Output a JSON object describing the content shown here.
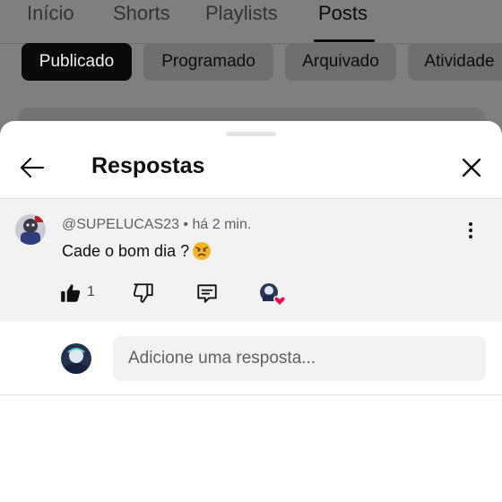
{
  "background": {
    "tabs": [
      {
        "label": "Início"
      },
      {
        "label": "Shorts"
      },
      {
        "label": "Playlists"
      },
      {
        "label": "Posts"
      }
    ],
    "active_tab": "Posts",
    "chips": [
      {
        "label": "Publicado"
      },
      {
        "label": "Programado"
      },
      {
        "label": "Arquivado"
      },
      {
        "label": "Atividade"
      }
    ],
    "active_chip": "Publicado"
  },
  "sheet": {
    "title": "Respostas",
    "icons": {
      "back": "arrow-left-icon",
      "close": "close-icon"
    }
  },
  "comment": {
    "author": "@SUPELUCAS23",
    "separator": "•",
    "time": "há 2 min.",
    "text": "Cade  o bom dia ?",
    "emoji": "angry-face",
    "like_count": "1",
    "icons": {
      "like": "thumbs-up-filled-icon",
      "dislike": "thumbs-down-icon",
      "reply": "comment-icon",
      "creator_heart": "creator-heart-icon",
      "more": "more-vertical-icon"
    }
  },
  "reply": {
    "placeholder": "Adicione uma resposta..."
  },
  "colors": {
    "overlay": "#7f7f7f",
    "sheet": "#ffffff",
    "comment_bg": "#f2f2f2",
    "heart": "#e0134a"
  }
}
